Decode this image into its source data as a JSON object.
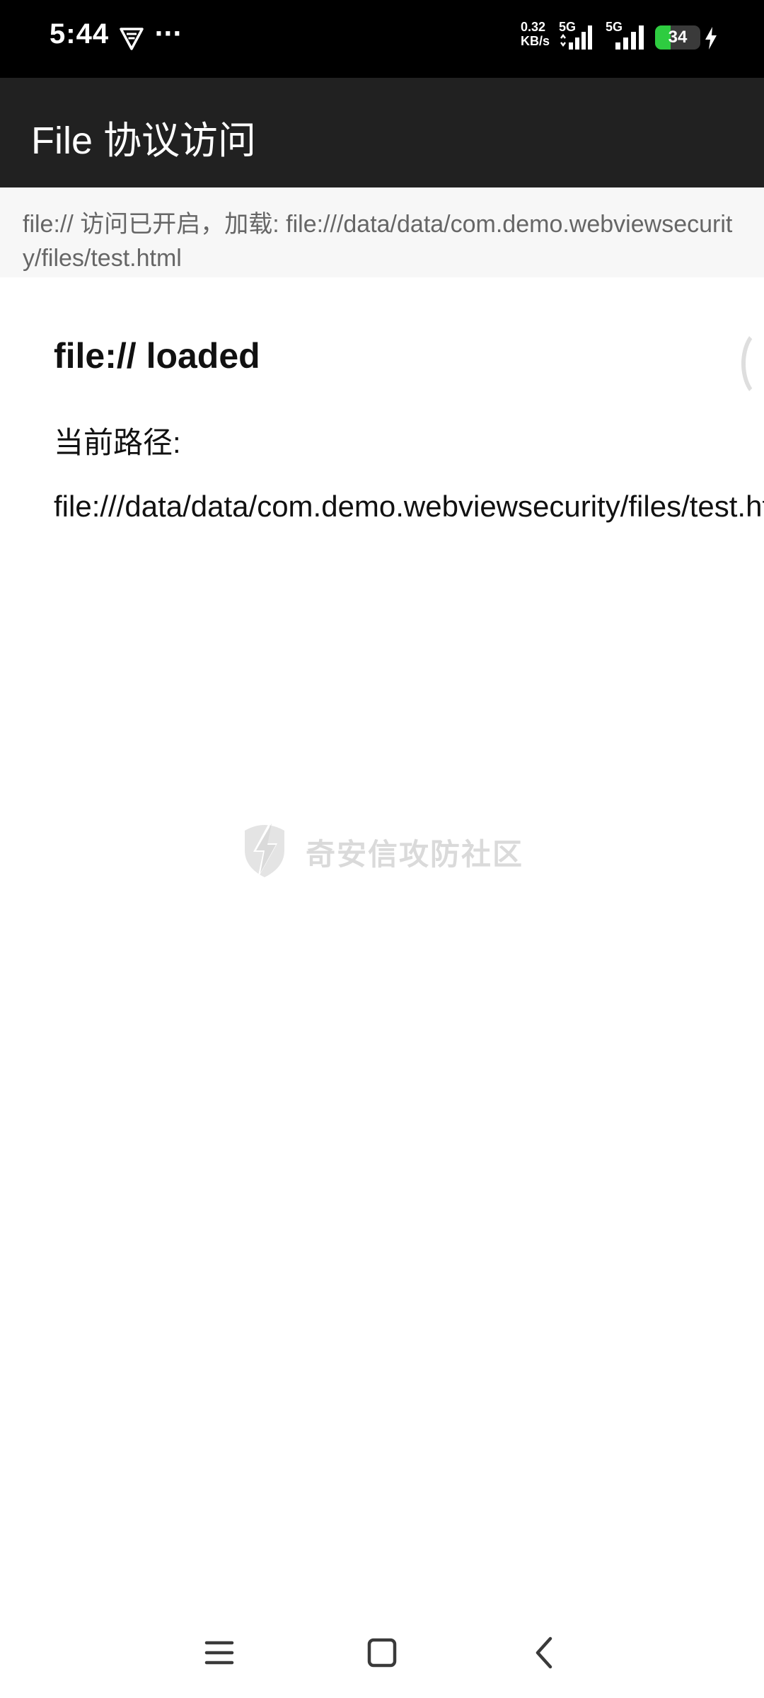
{
  "status_bar": {
    "time": "5:44",
    "more": "···",
    "speed_value": "0.32",
    "speed_unit": "KB/s",
    "network1": "5G",
    "network2": "5G",
    "battery_level": "34",
    "battery_fraction": 0.34,
    "battery_color": "#2ecc40",
    "icons": [
      "vpn-icon",
      "signal-icon",
      "signal-icon",
      "battery-icon",
      "charging-icon"
    ]
  },
  "app_bar": {
    "title": "File 协议访问"
  },
  "info_banner": {
    "text": "file:// 访问已开启，加载: file:///data/data/com.demo.webviewsecurity/files/test.html"
  },
  "web_page": {
    "heading": "file:// loaded",
    "path_label": "当前路径:",
    "path_value": "file:///data/data/com.demo.webviewsecurity/files/test.html"
  },
  "watermark": {
    "text": "奇安信攻防社区",
    "icon": "lightning-shield-icon"
  },
  "nav_bar": {
    "icons": [
      "menu-icon",
      "home-square-icon",
      "back-chevron-icon"
    ]
  },
  "colors": {
    "status_bar_bg": "#000000",
    "app_bar_bg": "#212121",
    "banner_bg": "#f7f7f7",
    "banner_text": "#666666"
  }
}
